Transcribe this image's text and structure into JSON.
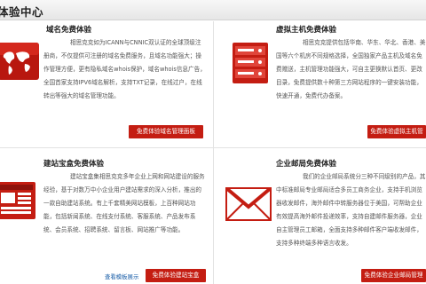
{
  "header": {
    "title": "体验中心"
  },
  "cards": {
    "domain": {
      "title": "域名免费体验",
      "desc": "相思克克如为ICANN与CNNIC双认证的全球顶级注册商，不仅提供可注册的域名免费服务，且域名功能强大；操作管理方便，更有隐私域名whois保护，域名whois信息广告，全国首家支持IPV6域名解析，支持TXT记录，在线过户，在线转出等强大的域名管理功能。",
      "button": "免费体验域名管理面板"
    },
    "hosting": {
      "title": "虚拟主机免费体验",
      "desc": "相思克克提供包括华南、华东、华北、香港、美国等六个机房不同规格选择，全国独家产品主机及域名免费赠送，主机管理功能强大，可自主更换默认首页、更改目录，免费提供数十种第三方网站程序的一键安装功能，快速开通，免费代办备案。",
      "button": "免费体验虚拟主机管"
    },
    "sitebuilder": {
      "title": "建站宝盒免费体验",
      "desc": "建站宝盒集相思克克多年企业上网和网站建设的服务经验，基于对数万中小企业用户建站需求的深入分析，推出的一款自助建站系统。有上千套精美网站模板，上百种网站功能，包括新闻系统、在线支付系统、客服系统、产品发布系统、会员系统、招聘系统、留言板、网站推广等功能。",
      "link": "查看模板展示",
      "button": "免费体验建站宝盒"
    },
    "mail": {
      "title": "企业邮局免费体验",
      "desc": "我们的企业邮局系统分三种不同级别的产品，其中标准邮局专业邮局适合多员工商务企业，支持手机浏览器收发邮件，海外邮件中转服务器位于美国，可帮助企业有效提高海外邮件投递效率，支持自建邮件服务器，企业自主管理员工邮箱，全面支持多种邮件客户端收发邮件，支持多种终端多种语言收发。",
      "button": "免费体验企业邮局管理"
    }
  },
  "colors": {
    "accent": "#c41d12",
    "link": "#1a5ea8"
  }
}
